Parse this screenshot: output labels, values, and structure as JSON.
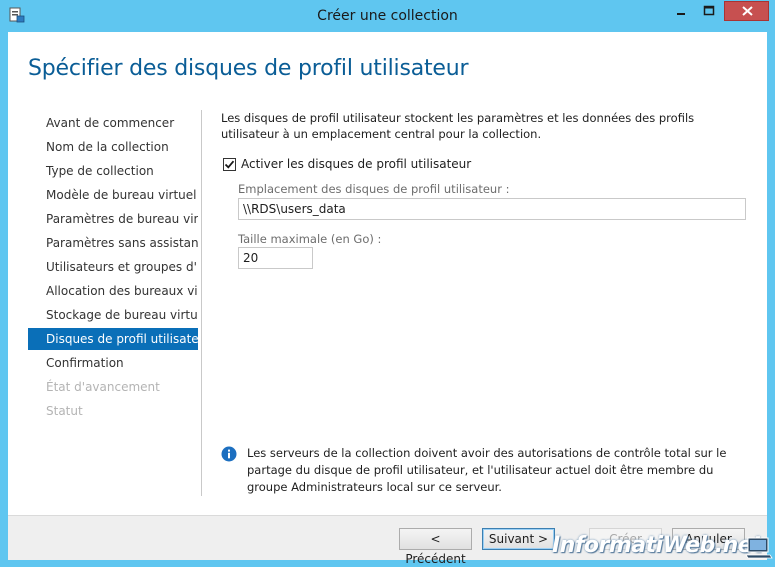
{
  "window": {
    "title": "Créer une collection"
  },
  "page_title": "Spécifier des disques de profil utilisateur",
  "nav": {
    "items": [
      {
        "label": "Avant de commencer",
        "state": "normal"
      },
      {
        "label": "Nom de la collection",
        "state": "normal"
      },
      {
        "label": "Type de collection",
        "state": "normal"
      },
      {
        "label": "Modèle de bureau virtuel",
        "state": "normal"
      },
      {
        "label": "Paramètres de bureau virt...",
        "state": "normal"
      },
      {
        "label": "Paramètres sans assistance",
        "state": "normal"
      },
      {
        "label": "Utilisateurs et groupes d'...",
        "state": "normal"
      },
      {
        "label": "Allocation des bureaux vir...",
        "state": "normal"
      },
      {
        "label": "Stockage de bureau virtuel",
        "state": "normal"
      },
      {
        "label": "Disques de profil utilisateur",
        "state": "selected"
      },
      {
        "label": "Confirmation",
        "state": "normal"
      },
      {
        "label": "État d'avancement",
        "state": "disabled"
      },
      {
        "label": "Statut",
        "state": "disabled"
      }
    ]
  },
  "content": {
    "description": "Les disques de profil utilisateur stockent les paramètres et les données des profils utilisateur à un emplacement central pour la collection.",
    "enable_checkbox": {
      "label": "Activer les disques de profil utilisateur",
      "checked": true
    },
    "location": {
      "label": "Emplacement des disques de profil utilisateur :",
      "value": "\\\\RDS\\users_data"
    },
    "max_size": {
      "label": "Taille maximale (en Go) :",
      "value": "20"
    },
    "info": "Les serveurs de la collection doivent avoir des autorisations de contrôle total sur le partage du disque de profil utilisateur, et l'utilisateur actuel doit être membre du groupe Administrateurs local sur ce serveur."
  },
  "buttons": {
    "previous": "< Précédent",
    "next": "Suivant >",
    "create": "Créer",
    "cancel": "Annuler"
  },
  "watermark": "InformatiWeb.net",
  "colors": {
    "frame": "#5fc6f0",
    "title_accent": "#0a5d96",
    "selected_nav": "#0a6fb8",
    "close_button": "#c75050"
  }
}
